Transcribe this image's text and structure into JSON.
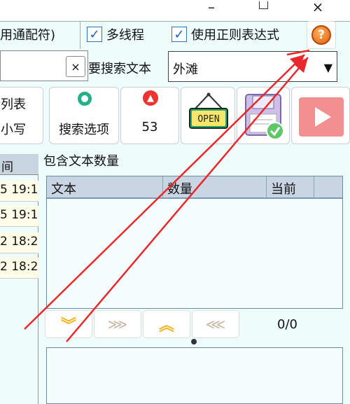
{
  "window": {
    "minimize_glyph": "–",
    "close_glyph": "×"
  },
  "toolbar": {
    "wildcard_label": "用通配符)",
    "multithread_label": "多线程",
    "multithread_checked": true,
    "regex_label": "使用正则表达式",
    "regex_checked": true,
    "help_glyph": "?"
  },
  "search": {
    "clear_glyph": "×",
    "search_text_label": "要搜索文本",
    "combo_value": "外滩",
    "combo_arrow": "▼"
  },
  "buttons": {
    "list_label": "列表",
    "case_label": "小写",
    "options_label": "搜索选项",
    "count_value": "53",
    "open_text": "OPEN"
  },
  "left_table": {
    "header": "间",
    "rows": [
      "5 19:1",
      "5 19:1",
      "2 18:2",
      "2 18:2"
    ]
  },
  "count_panel": {
    "title": "包含文本数量",
    "columns": [
      "文本",
      "数量",
      "当前"
    ]
  },
  "nav": {
    "position_text": "0/0"
  },
  "colors": {
    "background": "#eefcfc",
    "accent_red": "#e8282a",
    "header_blue": "#c9d5e2"
  }
}
